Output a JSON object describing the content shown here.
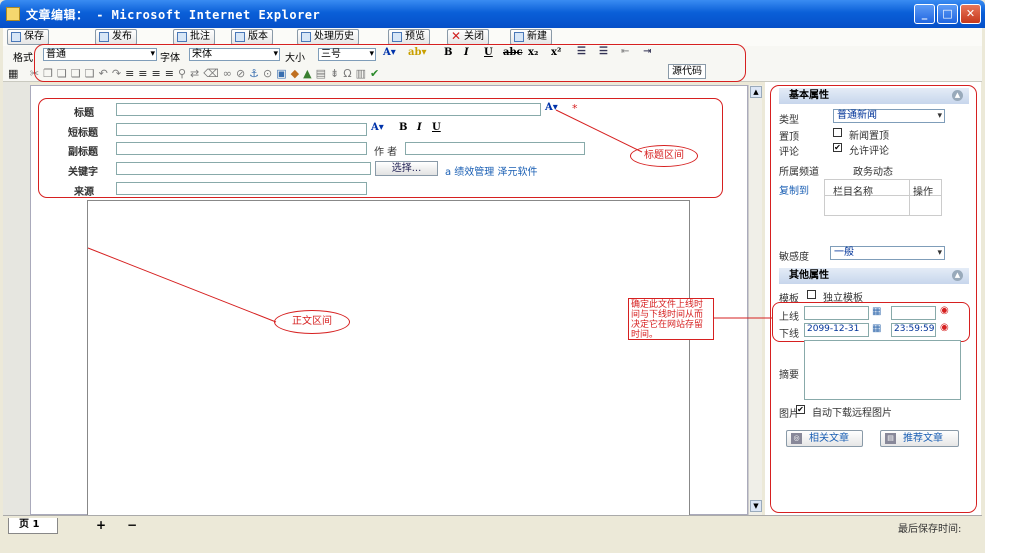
{
  "window": {
    "title": "文章编辑： - Microsoft Internet Explorer"
  },
  "toolbar": {
    "save": "保存",
    "publish": "发布",
    "annotate": "批注",
    "version": "版本",
    "history": "处理历史",
    "preview": "预览",
    "close": "关闭",
    "new": "新建"
  },
  "format": {
    "format_label": "格式",
    "format_value": "普通",
    "font_label": "字体",
    "font_value": "宋体",
    "size_label": "大小",
    "size_value": "三号",
    "source_code": "源代码"
  },
  "form": {
    "title_label": "标题",
    "short_title_label": "短标题",
    "subtitle_label": "副标题",
    "author_label": "作 者",
    "keywords_label": "关键字",
    "source_label": "来源",
    "select_button": "选择...",
    "keywords_value": "a 绩效管理 泽元软件"
  },
  "annotations": {
    "title_area": "标题区间",
    "body_area": "正文区间",
    "online_note": "确定此文件上线时间与下线时间从而决定它在网站存留时间。"
  },
  "basic_props": {
    "header": "基本属性",
    "type_label": "类型",
    "type_value": "普通新闻",
    "pin_label": "置顶",
    "pin_option": "新闻置顶",
    "comment_label": "评论",
    "comment_option": "允许评论",
    "channel_label": "所属频道",
    "channel_value": "政务动态",
    "copy_label": "复制到",
    "col_name": "栏目名称",
    "col_action": "操作",
    "sensitivity_label": "敏感度",
    "sensitivity_value": "一般"
  },
  "other_props": {
    "header": "其他属性",
    "template_label": "模板",
    "template_option": "独立模板",
    "online_label": "上线",
    "offline_label": "下线",
    "offline_date": "2099-12-31",
    "offline_time": "23:59:59",
    "summary_label": "摘要",
    "image_label": "图片",
    "image_option": "自动下载远程图片",
    "related_button": "相关文章",
    "recommend_button": "推荐文章"
  },
  "status": {
    "page_tab": "页 1",
    "add": "+",
    "remove": "−",
    "last_saved": "最后保存时间:"
  }
}
